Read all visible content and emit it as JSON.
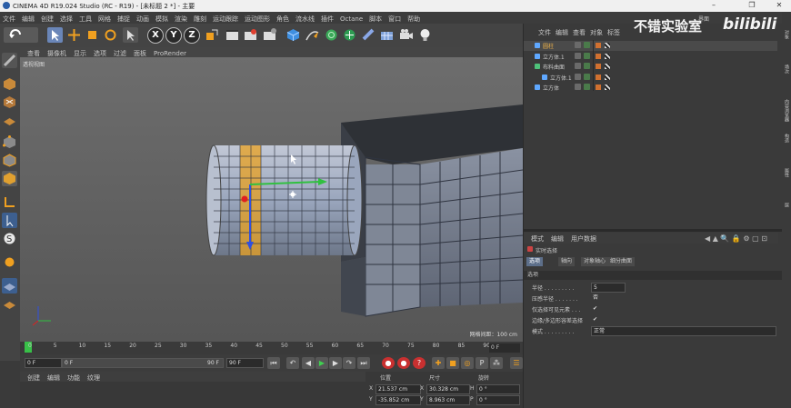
{
  "window": {
    "title": "CINEMA 4D R19.024 Studio (RC - R19) - [未标题 2 *] - 主要"
  },
  "menu": [
    "文件",
    "编辑",
    "创建",
    "选择",
    "工具",
    "网格",
    "捕捉",
    "动画",
    "模拟",
    "渲染",
    "雕刻",
    "运动跟踪",
    "运动图形",
    "角色",
    "流水线",
    "插件",
    "Octane",
    "脚本",
    "窗口",
    "帮助"
  ],
  "layout_label": "界面",
  "viewport": {
    "menu": [
      "查看",
      "摄像机",
      "显示",
      "选项",
      "过滤",
      "面板",
      "ProRender"
    ],
    "label": "透视视图",
    "grid_label": "网格间距：100 cm"
  },
  "timeline": {
    "ticks": [
      "0",
      "5",
      "10",
      "15",
      "20",
      "25",
      "30",
      "35",
      "40",
      "45",
      "50",
      "55",
      "60",
      "65",
      "70",
      "75",
      "80",
      "85",
      "90"
    ],
    "current_frame": "0 F",
    "start_field": "0 F",
    "min_field": "0 F",
    "max_field": "90 F",
    "end_field": "90 F"
  },
  "material_menu": [
    "创建",
    "编辑",
    "功能",
    "纹理"
  ],
  "coords": {
    "headers": [
      "位置",
      "尺寸",
      "旋转"
    ],
    "rows": [
      {
        "axis": "X",
        "pos": "21.537 cm",
        "size_axis": "X",
        "size": "30.328 cm",
        "rot_axis": "H",
        "rot": "0 °"
      },
      {
        "axis": "Y",
        "pos": "-35.852 cm",
        "size_axis": "Y",
        "size": "8.963 cm",
        "rot_axis": "P",
        "rot": "0 °"
      }
    ]
  },
  "objects": {
    "menu": [
      "文件",
      "编辑",
      "查看",
      "对象",
      "标签"
    ],
    "items": [
      {
        "name": "圆柱",
        "indent": 0,
        "selected": true,
        "color": "#5fa8ff"
      },
      {
        "name": "立方体.1",
        "indent": 0,
        "selected": false,
        "color": "#5fa8ff"
      },
      {
        "name": "布料曲面",
        "indent": 0,
        "selected": false,
        "color": "#4ec27a"
      },
      {
        "name": "立方体.1",
        "indent": 1,
        "selected": false,
        "color": "#5fa8ff"
      },
      {
        "name": "立方体",
        "indent": 0,
        "selected": false,
        "color": "#5fa8ff"
      }
    ]
  },
  "attributes": {
    "menu": [
      "模式",
      "编辑",
      "用户数据"
    ],
    "title": "实时选择",
    "tabs": [
      "选项",
      "轴向",
      "对象轴心",
      "细分曲面"
    ],
    "section": "选项",
    "params": [
      {
        "label": "半径 . . . . . . . . .",
        "value": "5"
      },
      {
        "label": "压感半径 . . . . . . .",
        "value": "否"
      },
      {
        "label": "仅选择可见元素 . . .",
        "value": "✔"
      },
      {
        "label": "边缘/多边形容差选择",
        "value": "✔"
      },
      {
        "label": "模式 . . . . . . . . .",
        "value": "正常"
      }
    ]
  },
  "right_tabs": [
    "对象",
    "场次",
    "内容浏览器",
    "构造",
    "属性",
    "层"
  ],
  "watermark": {
    "text1": "不错实验室",
    "text2": "bilibili"
  },
  "colors": {
    "accent": "#5d6f8a",
    "selected_text": "#f0b44a",
    "cylinder_band": "#e8a020"
  }
}
